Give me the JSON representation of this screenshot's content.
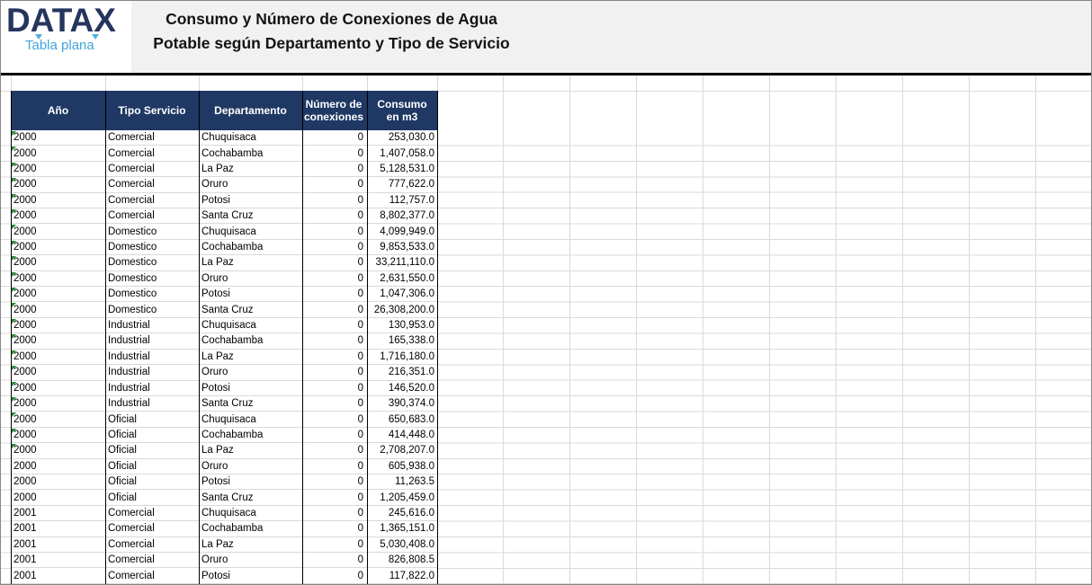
{
  "brand": {
    "logo": "DATAX",
    "subtitle": "Tabla plana",
    "logo_color": "#26355E",
    "subtitle_color": "#3FA5DB"
  },
  "header": {
    "title_line1": "Consumo y Número de Conexiones de Agua",
    "title_line2": "Potable según Departamento y Tipo de Servicio"
  },
  "table": {
    "header_bg": "#1F3864",
    "columns": [
      "Año",
      "Tipo Servicio",
      "Departamento",
      "Número de conexiones",
      "Consumo en m3"
    ],
    "rows": [
      {
        "year": "2000",
        "service": "Comercial",
        "department": "Chuquisaca",
        "connections": "0",
        "consumption": "253,030.0",
        "flag": true
      },
      {
        "year": "2000",
        "service": "Comercial",
        "department": "Cochabamba",
        "connections": "0",
        "consumption": "1,407,058.0",
        "flag": true
      },
      {
        "year": "2000",
        "service": "Comercial",
        "department": "La Paz",
        "connections": "0",
        "consumption": "5,128,531.0",
        "flag": true
      },
      {
        "year": "2000",
        "service": "Comercial",
        "department": "Oruro",
        "connections": "0",
        "consumption": "777,622.0",
        "flag": true
      },
      {
        "year": "2000",
        "service": "Comercial",
        "department": "Potosi",
        "connections": "0",
        "consumption": "112,757.0",
        "flag": true
      },
      {
        "year": "2000",
        "service": "Comercial",
        "department": "Santa Cruz",
        "connections": "0",
        "consumption": "8,802,377.0",
        "flag": true
      },
      {
        "year": "2000",
        "service": "Domestico",
        "department": "Chuquisaca",
        "connections": "0",
        "consumption": "4,099,949.0",
        "flag": true
      },
      {
        "year": "2000",
        "service": "Domestico",
        "department": "Cochabamba",
        "connections": "0",
        "consumption": "9,853,533.0",
        "flag": true
      },
      {
        "year": "2000",
        "service": "Domestico",
        "department": "La Paz",
        "connections": "0",
        "consumption": "33,211,110.0",
        "flag": true
      },
      {
        "year": "2000",
        "service": "Domestico",
        "department": "Oruro",
        "connections": "0",
        "consumption": "2,631,550.0",
        "flag": true
      },
      {
        "year": "2000",
        "service": "Domestico",
        "department": "Potosi",
        "connections": "0",
        "consumption": "1,047,306.0",
        "flag": true
      },
      {
        "year": "2000",
        "service": "Domestico",
        "department": "Santa Cruz",
        "connections": "0",
        "consumption": "26,308,200.0",
        "flag": true
      },
      {
        "year": "2000",
        "service": "Industrial",
        "department": "Chuquisaca",
        "connections": "0",
        "consumption": "130,953.0",
        "flag": true
      },
      {
        "year": "2000",
        "service": "Industrial",
        "department": "Cochabamba",
        "connections": "0",
        "consumption": "165,338.0",
        "flag": true
      },
      {
        "year": "2000",
        "service": "Industrial",
        "department": "La Paz",
        "connections": "0",
        "consumption": "1,716,180.0",
        "flag": true
      },
      {
        "year": "2000",
        "service": "Industrial",
        "department": "Oruro",
        "connections": "0",
        "consumption": "216,351.0",
        "flag": true
      },
      {
        "year": "2000",
        "service": "Industrial",
        "department": "Potosi",
        "connections": "0",
        "consumption": "146,520.0",
        "flag": true
      },
      {
        "year": "2000",
        "service": "Industrial",
        "department": "Santa Cruz",
        "connections": "0",
        "consumption": "390,374.0",
        "flag": true
      },
      {
        "year": "2000",
        "service": "Oficial",
        "department": "Chuquisaca",
        "connections": "0",
        "consumption": "650,683.0",
        "flag": true
      },
      {
        "year": "2000",
        "service": "Oficial",
        "department": "Cochabamba",
        "connections": "0",
        "consumption": "414,448.0",
        "flag": true
      },
      {
        "year": "2000",
        "service": "Oficial",
        "department": "La Paz",
        "connections": "0",
        "consumption": "2,708,207.0",
        "flag": true
      },
      {
        "year": "2000",
        "service": "Oficial",
        "department": "Oruro",
        "connections": "0",
        "consumption": "605,938.0",
        "flag": false
      },
      {
        "year": "2000",
        "service": "Oficial",
        "department": "Potosi",
        "connections": "0",
        "consumption": "11,263.5",
        "flag": false
      },
      {
        "year": "2000",
        "service": "Oficial",
        "department": "Santa Cruz",
        "connections": "0",
        "consumption": "1,205,459.0",
        "flag": false
      },
      {
        "year": "2001",
        "service": "Comercial",
        "department": "Chuquisaca",
        "connections": "0",
        "consumption": "245,616.0",
        "flag": false
      },
      {
        "year": "2001",
        "service": "Comercial",
        "department": "Cochabamba",
        "connections": "0",
        "consumption": "1,365,151.0",
        "flag": false
      },
      {
        "year": "2001",
        "service": "Comercial",
        "department": "La Paz",
        "connections": "0",
        "consumption": "5,030,408.0",
        "flag": false
      },
      {
        "year": "2001",
        "service": "Comercial",
        "department": "Oruro",
        "connections": "0",
        "consumption": "826,808.5",
        "flag": false
      },
      {
        "year": "2001",
        "service": "Comercial",
        "department": "Potosi",
        "connections": "0",
        "consumption": "117,822.0",
        "flag": false
      }
    ]
  }
}
